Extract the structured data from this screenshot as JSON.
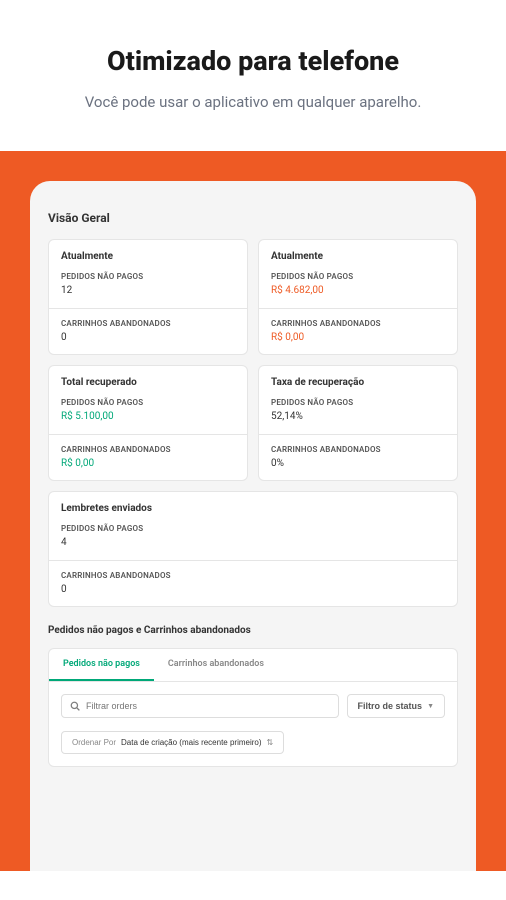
{
  "header": {
    "title": "Otimizado para telefone",
    "subtitle": "Você pode usar o aplicativo em qualquer aparelho."
  },
  "overview": {
    "title": "Visão Geral",
    "cards": [
      {
        "title": "Atualmente",
        "metric1_label": "PEDIDOS NÃO PAGOS",
        "metric1_value": "12",
        "metric1_class": "",
        "metric2_label": "CARRINHOS ABANDONADOS",
        "metric2_value": "0",
        "metric2_class": ""
      },
      {
        "title": "Atualmente",
        "metric1_label": "PEDIDOS NÃO PAGOS",
        "metric1_value": "R$ 4.682,00",
        "metric1_class": "value-orange",
        "metric2_label": "CARRINHOS ABANDONADOS",
        "metric2_value": "R$ 0,00",
        "metric2_class": "value-orange"
      },
      {
        "title": "Total recuperado",
        "metric1_label": "PEDIDOS NÃO PAGOS",
        "metric1_value": "R$ 5.100,00",
        "metric1_class": "value-green",
        "metric2_label": "CARRINHOS ABANDONADOS",
        "metric2_value": "R$ 0,00",
        "metric2_class": "value-green"
      },
      {
        "title": "Taxa de recuperação",
        "metric1_label": "PEDIDOS NÃO PAGOS",
        "metric1_value": "52,14%",
        "metric1_class": "",
        "metric2_label": "CARRINHOS ABANDONADOS",
        "metric2_value": "0%",
        "metric2_class": ""
      }
    ],
    "reminders": {
      "title": "Lembretes enviados",
      "metric1_label": "PEDIDOS NÃO PAGOS",
      "metric1_value": "4",
      "metric2_label": "CARRINHOS ABANDONADOS",
      "metric2_value": "0"
    }
  },
  "table": {
    "title": "Pedidos não pagos e Carrinhos abandonados",
    "tabs": [
      "Pedidos não pagos",
      "Carrinhos abandonados"
    ],
    "search_placeholder": "Filtrar orders",
    "filter_button": "Filtro de status",
    "sort_label": "Ordenar Por",
    "sort_value": "Data de criação (mais recente primeiro)"
  }
}
